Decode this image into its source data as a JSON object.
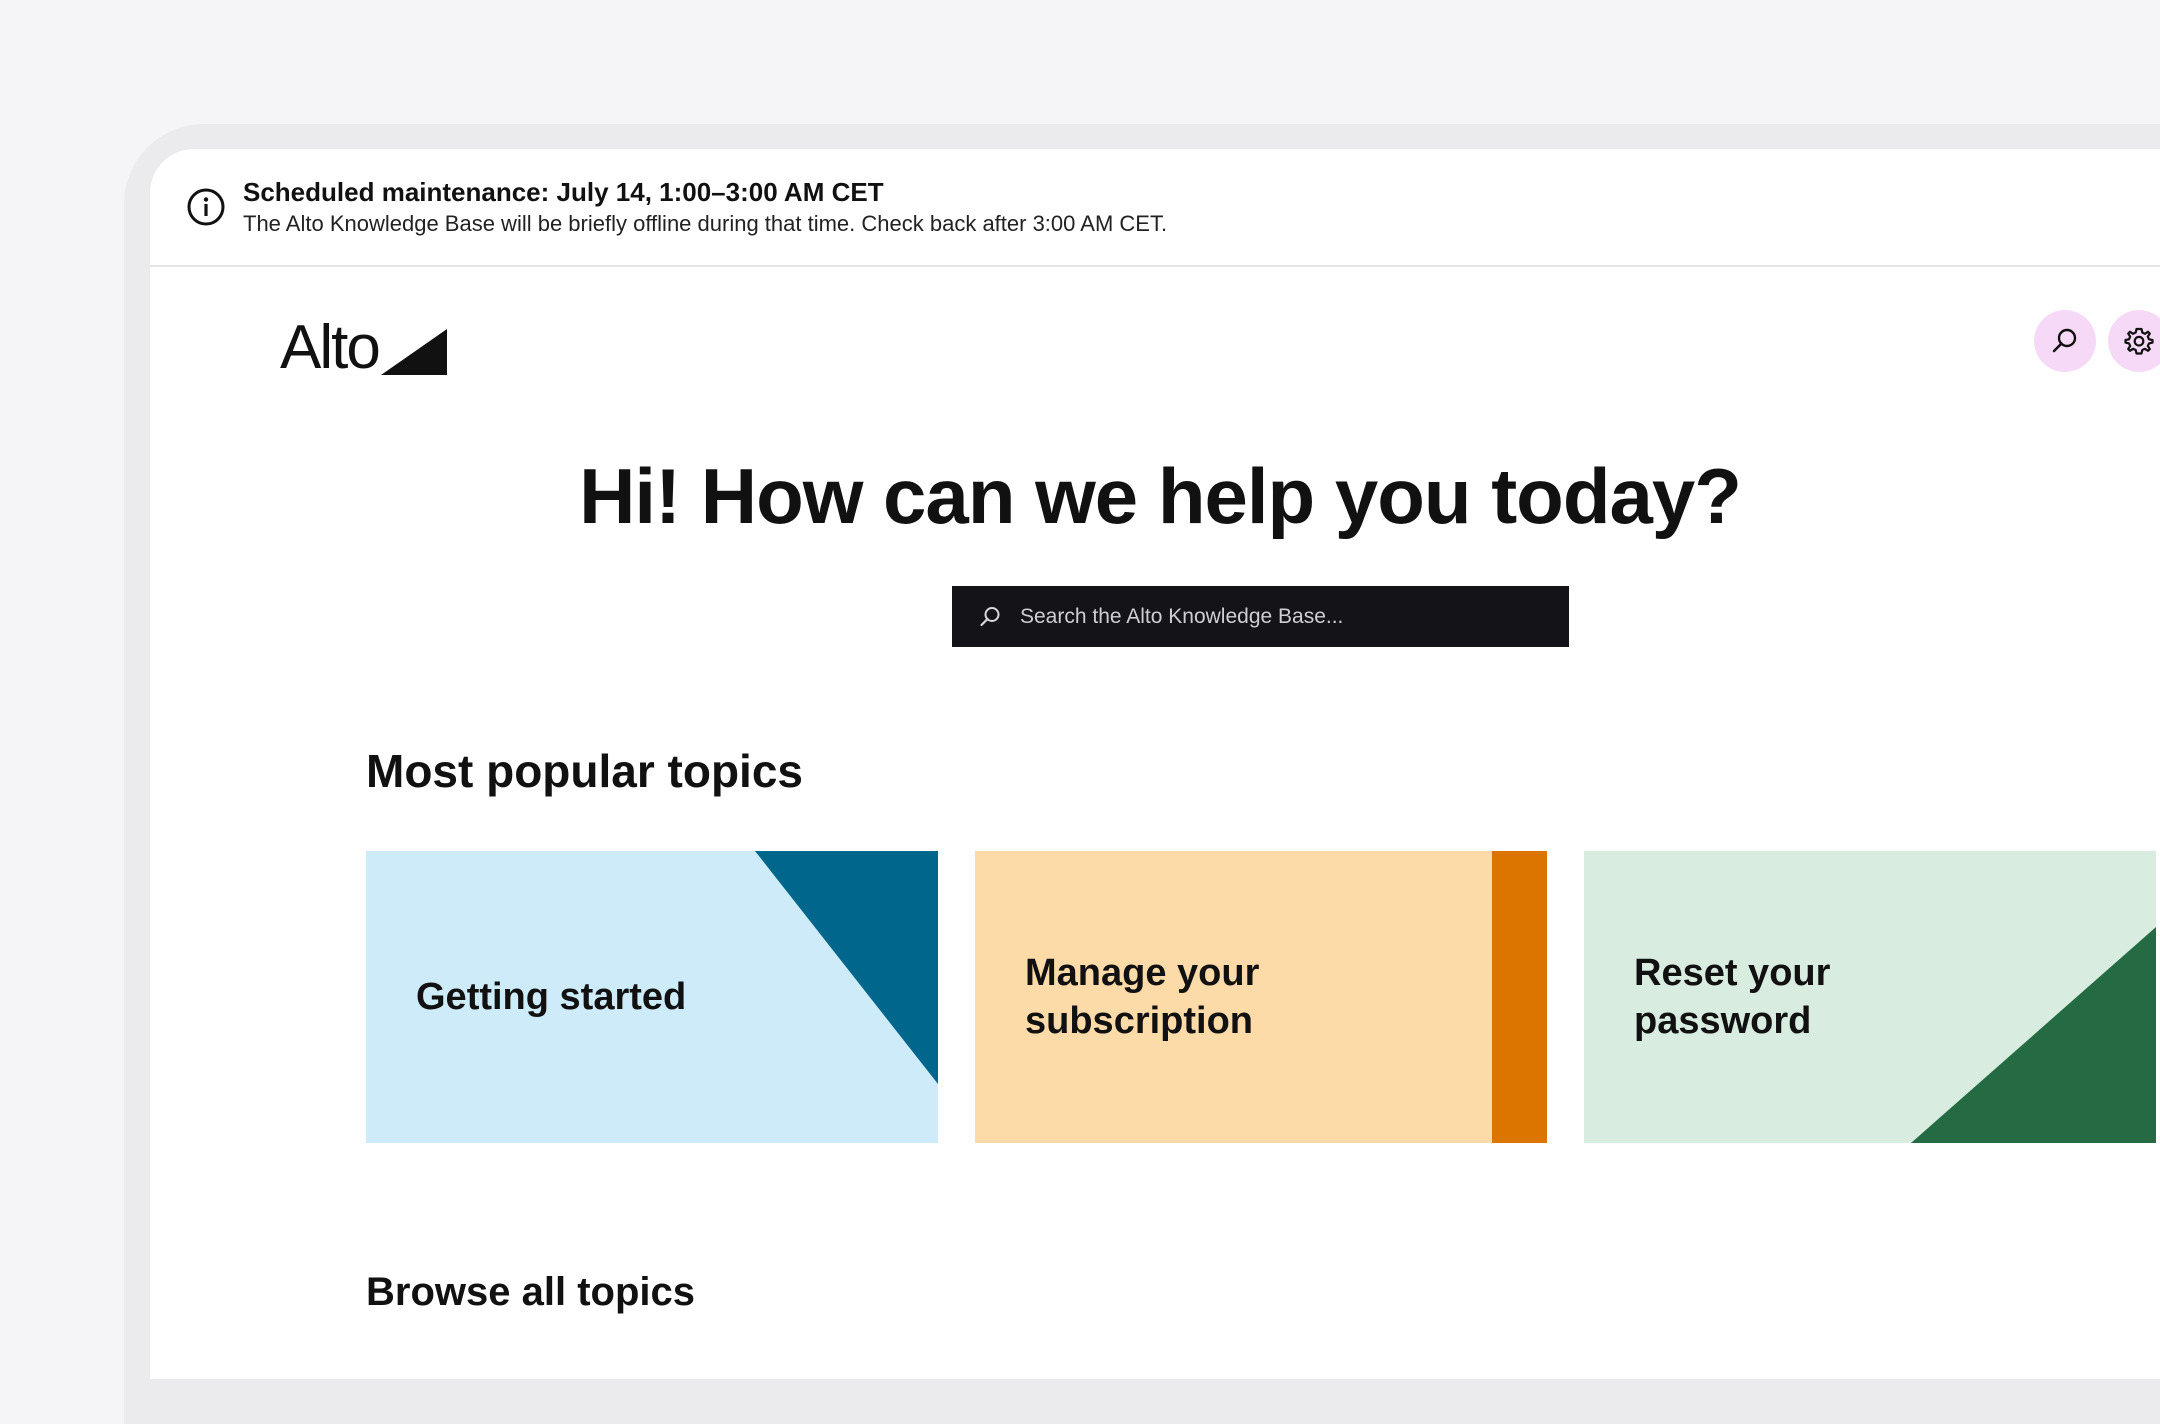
{
  "banner": {
    "icon": "info-icon",
    "title": "Scheduled maintenance: July 14, 1:00–3:00 AM CET",
    "message": "The Alto Knowledge Base will be briefly offline during that time. Check back after 3:00 AM CET."
  },
  "header": {
    "logo_text": "Alto",
    "logo_icon": "triangle-logo-mark",
    "search_icon": "search-icon",
    "settings_icon": "gear-icon",
    "button_color": "#f6d9f6"
  },
  "hero": {
    "headline": "Hi! How can we help you today?",
    "search_placeholder": "Search the Alto Knowledge Base..."
  },
  "popular": {
    "title": "Most popular topics",
    "cards": [
      {
        "label": "Getting started",
        "bg": "#cdebf8",
        "accent": "#00668c"
      },
      {
        "label": "Manage your subscription",
        "bg": "#fddba8",
        "accent": "#db7500"
      },
      {
        "label": "Reset your password",
        "bg": "#d8ece0",
        "accent": "#246b43"
      }
    ]
  },
  "browse": {
    "title": "Browse all topics"
  }
}
